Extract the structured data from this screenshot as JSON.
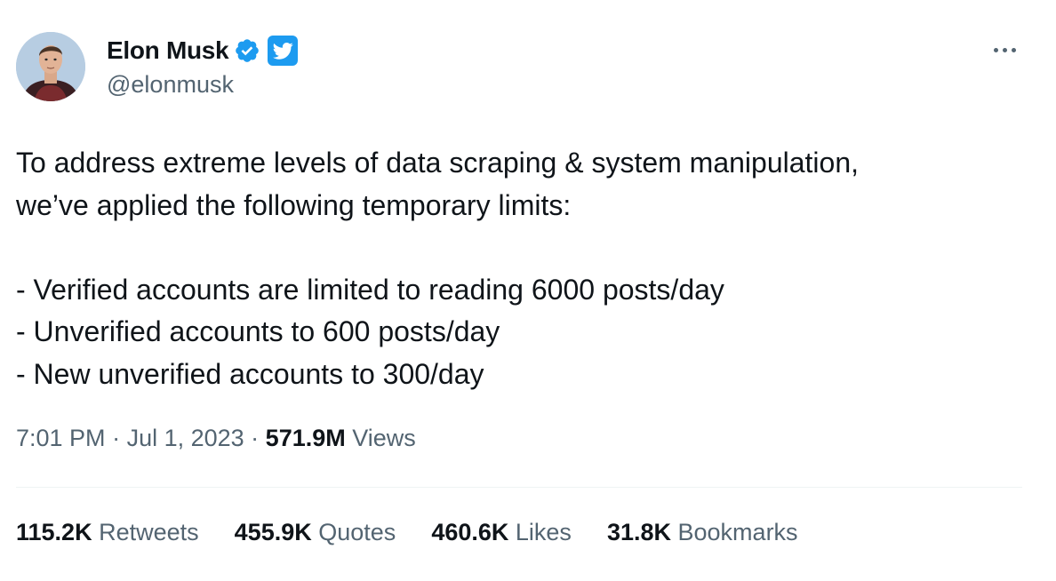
{
  "author": {
    "display_name": "Elon Musk",
    "handle": "@elonmusk",
    "verified_icon": "verified-badge-icon",
    "affiliate_icon": "twitter-bird-icon"
  },
  "menu": {
    "more_icon": "more-horizontal-icon"
  },
  "tweet": {
    "lines": [
      "To address extreme levels of data scraping & system manipulation,",
      "we’ve applied the following temporary limits:",
      "",
      "- Verified accounts are limited to reading 6000 posts/day",
      "- Unverified accounts to 600 posts/day",
      "- New unverified accounts to 300/day"
    ]
  },
  "meta": {
    "time": "7:01 PM",
    "separator": " · ",
    "date": "Jul 1, 2023",
    "views_count": "571.9M",
    "views_label": "Views"
  },
  "stats": {
    "retweets_count": "115.2K",
    "retweets_label": "Retweets",
    "quotes_count": "455.9K",
    "quotes_label": "Quotes",
    "likes_count": "460.6K",
    "likes_label": "Likes",
    "bookmarks_count": "31.8K",
    "bookmarks_label": "Bookmarks"
  },
  "colors": {
    "text_primary": "#0f1419",
    "text_secondary": "#536471",
    "accent": "#1d9bf0",
    "divider": "#eff3f4"
  }
}
